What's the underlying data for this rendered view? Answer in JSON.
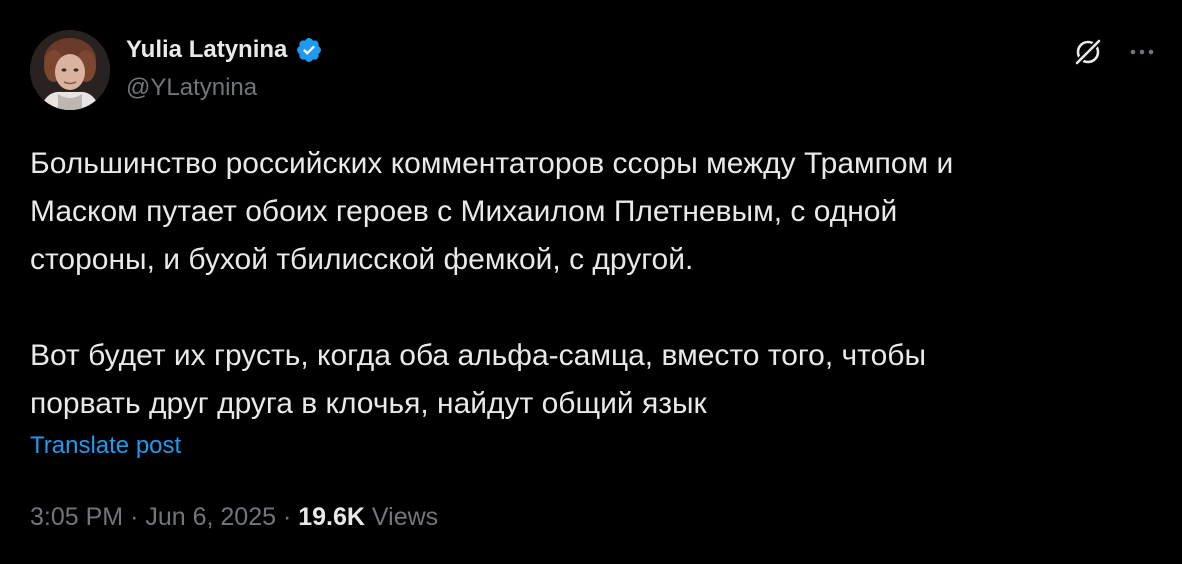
{
  "author": {
    "display_name": "Yulia Latynina",
    "handle": "@YLatynina",
    "verified": true
  },
  "icons": {
    "avatar": "profile-photo",
    "verified": "verified-badge-icon",
    "grok": "grok-icon",
    "more": "more-options-icon"
  },
  "post": {
    "paragraph_1": "Большинство российских комментаторов ссоры между Трампом и\nМаском путает обоих героев с Михаилом Плетневым, с одной\nстороны, и бухой тбилисской фемкой, с другой.",
    "paragraph_2": "Вот будет их грусть, когда оба альфа-самца, вместо того, чтобы\nпорвать друг друга в клочья, найдут общий язык",
    "translate_label": "Translate post"
  },
  "meta": {
    "time": "3:05 PM",
    "separator": "·",
    "date": "Jun 6, 2025",
    "views_count": "19.6K",
    "views_label": "Views"
  },
  "colors": {
    "background": "#000000",
    "text": "#e7e9ea",
    "secondary": "#71767b",
    "accent": "#1d9bf0"
  }
}
